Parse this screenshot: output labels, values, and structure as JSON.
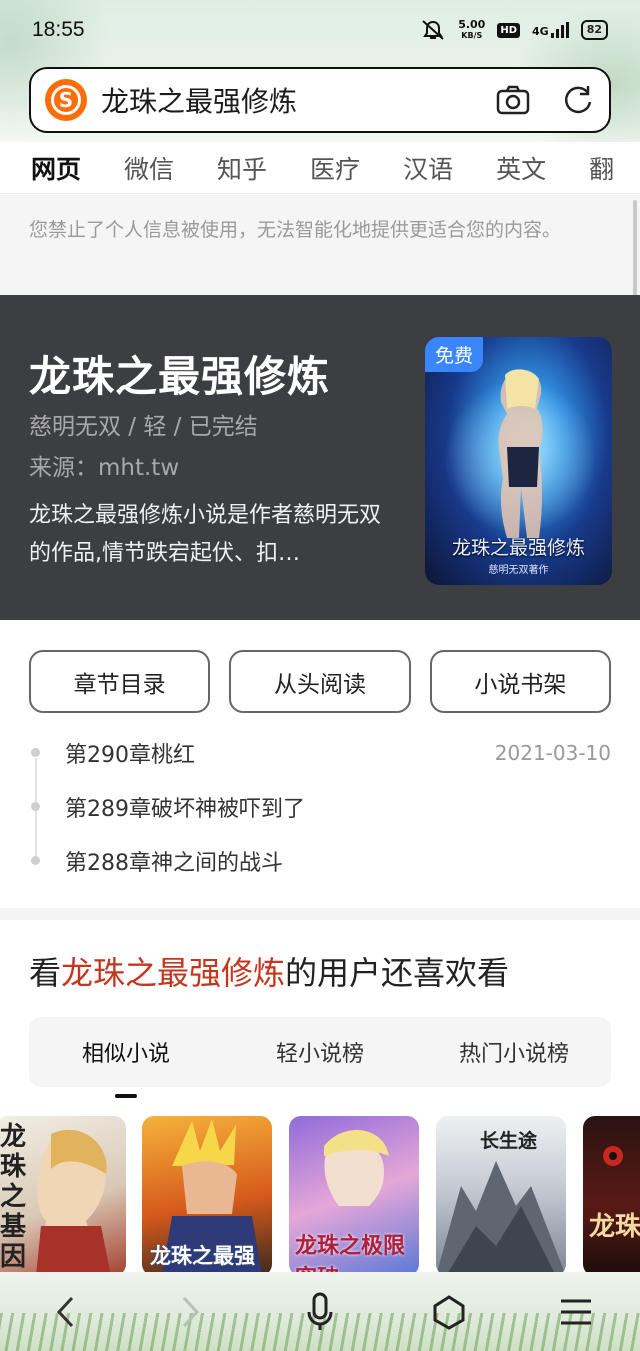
{
  "status_bar": {
    "time": "18:55",
    "net_speed": "5.00",
    "net_unit": "KB/S",
    "hd": "HD",
    "network": "4G",
    "battery": "82"
  },
  "search": {
    "query": "龙珠之最强修炼",
    "logo_letter": "S"
  },
  "tabs": [
    {
      "label": "网页",
      "active": true
    },
    {
      "label": "微信"
    },
    {
      "label": "知乎"
    },
    {
      "label": "医疗"
    },
    {
      "label": "汉语"
    },
    {
      "label": "英文"
    },
    {
      "label": "翻"
    }
  ],
  "notice": "您禁止了个人信息被使用，无法智能化地提供更适合您的内容。",
  "book": {
    "title": "龙珠之最强修炼",
    "meta": "慈明无双 / 轻 / 已完结",
    "source": "来源：mht.tw",
    "description": "龙珠之最强修炼小说是作者慈明无双的作品,情节跌宕起伏、扣…",
    "badge": "免费",
    "cover_title": "龙珠之最强修炼",
    "cover_author": "慈明无双著作"
  },
  "actions": [
    "章节目录",
    "从头阅读",
    "小说书架"
  ],
  "chapters": [
    {
      "title": "第290章桃红",
      "date": "2021-03-10"
    },
    {
      "title": "第289章破坏神被吓到了",
      "date": ""
    },
    {
      "title": "第288章神之间的战斗",
      "date": ""
    }
  ],
  "recommend": {
    "prefix": "看",
    "highlight": "龙珠之最强修炼",
    "suffix": "的用户还喜欢看",
    "tabs": [
      "相似小说",
      "轻小说榜",
      "热门小说榜"
    ],
    "covers": [
      {
        "text": "龙珠之基因"
      },
      {
        "text": "龙珠之最强修仙者"
      },
      {
        "text": "龙珠之极限突破"
      },
      {
        "text": "长生途"
      },
      {
        "text": "龙珠最强"
      }
    ]
  },
  "colors": {
    "accent": "#f86a0d",
    "highlight": "#c4361d",
    "card_bg": "#3d3e42",
    "badge": "#3a86ff"
  }
}
